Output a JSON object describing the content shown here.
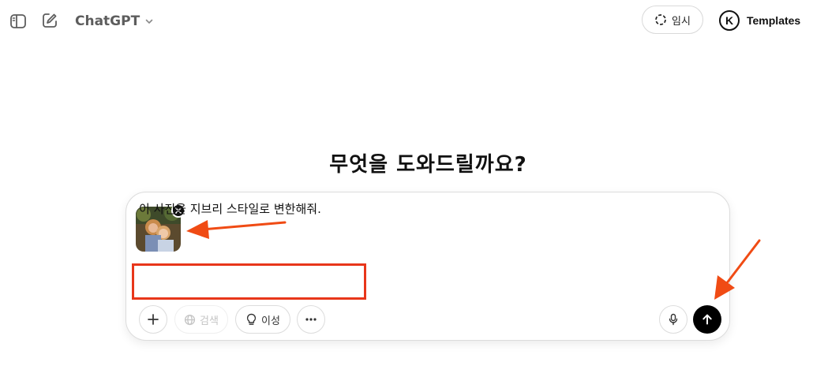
{
  "header": {
    "model_name": "ChatGPT",
    "temporary_label": "임시",
    "account_initial": "K",
    "account_name": "Templates"
  },
  "main": {
    "heading": "무엇을 도와드릴까요?"
  },
  "composer": {
    "prompt_text": "이 사진을 지브리 스타일로 변한해줘.",
    "attachment_icon": "photo-thumbnail",
    "tools": {
      "search_label": "검색",
      "reason_label": "이성"
    },
    "highlight_color": "#e8361a"
  }
}
